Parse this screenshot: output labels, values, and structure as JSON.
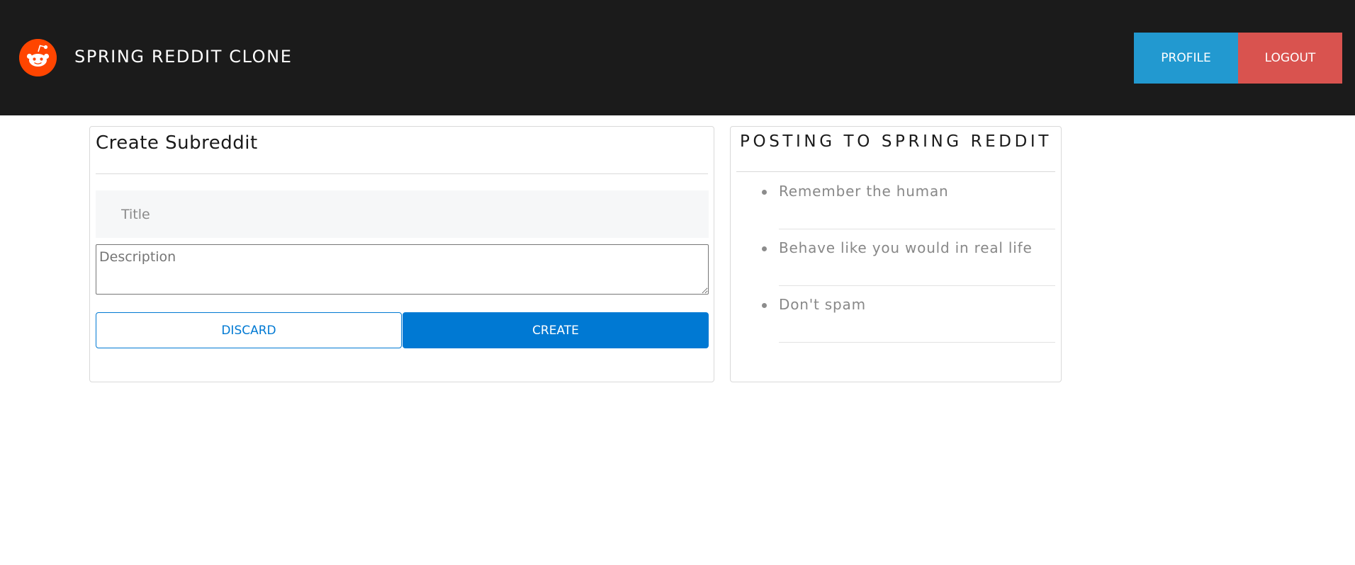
{
  "header": {
    "brand": "SPRING REDDIT CLONE",
    "logo_icon": "reddit-alien-icon",
    "profile_label": "PROFILE",
    "logout_label": "LOGOUT"
  },
  "create_form": {
    "title": "Create Subreddit",
    "title_placeholder": "Title",
    "title_value": "",
    "description_placeholder": "Description",
    "description_value": "",
    "discard_label": "DISCARD",
    "create_label": "CREATE"
  },
  "sidebar": {
    "heading": "POSTING TO SPRING REDDIT",
    "rules": [
      "Remember the human",
      "Behave like you would in real life",
      "Don't spam"
    ]
  },
  "colors": {
    "header_bg": "#1b1b1b",
    "logo_orange": "#ff4500",
    "profile_blue": "#2299d0",
    "logout_red": "#d9534f",
    "primary_blue": "#0079d3"
  }
}
